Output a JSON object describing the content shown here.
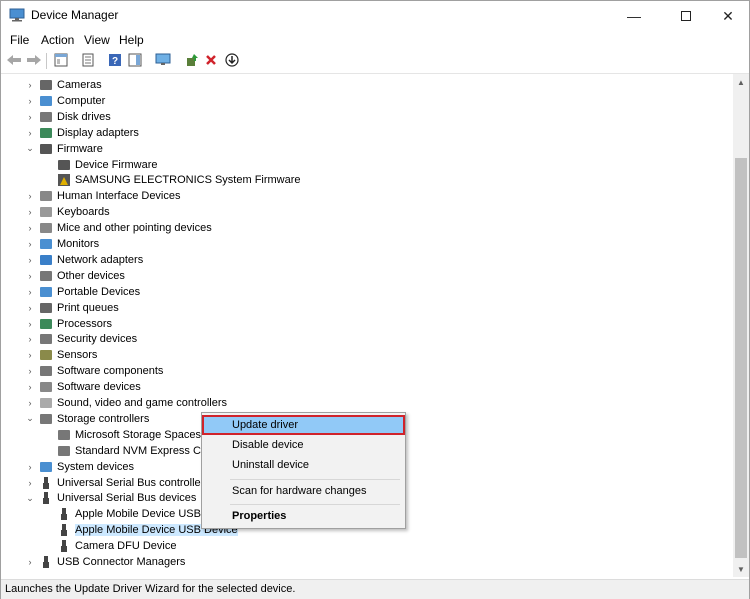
{
  "window": {
    "title": "Device Manager"
  },
  "menu": [
    "File",
    "Action",
    "View",
    "Help"
  ],
  "tree": [
    {
      "label": "Cameras",
      "level": 1,
      "expander": "collapsed",
      "icon": "camera-icon"
    },
    {
      "label": "Computer",
      "level": 1,
      "expander": "collapsed",
      "icon": "computer-icon"
    },
    {
      "label": "Disk drives",
      "level": 1,
      "expander": "collapsed",
      "icon": "disk-drive-icon"
    },
    {
      "label": "Display adapters",
      "level": 1,
      "expander": "collapsed",
      "icon": "display-adapter-icon"
    },
    {
      "label": "Firmware",
      "level": 1,
      "expander": "expanded",
      "icon": "firmware-icon"
    },
    {
      "label": "Device Firmware",
      "level": 2,
      "expander": "none",
      "icon": "firmware-icon"
    },
    {
      "label": "SAMSUNG ELECTRONICS System Firmware",
      "level": 2,
      "expander": "none",
      "icon": "warning-firmware-icon"
    },
    {
      "label": "Human Interface Devices",
      "level": 1,
      "expander": "collapsed",
      "icon": "hid-icon"
    },
    {
      "label": "Keyboards",
      "level": 1,
      "expander": "collapsed",
      "icon": "keyboard-icon"
    },
    {
      "label": "Mice and other pointing devices",
      "level": 1,
      "expander": "collapsed",
      "icon": "mouse-icon"
    },
    {
      "label": "Monitors",
      "level": 1,
      "expander": "collapsed",
      "icon": "monitor-icon"
    },
    {
      "label": "Network adapters",
      "level": 1,
      "expander": "collapsed",
      "icon": "network-adapter-icon"
    },
    {
      "label": "Other devices",
      "level": 1,
      "expander": "collapsed",
      "icon": "other-devices-icon"
    },
    {
      "label": "Portable Devices",
      "level": 1,
      "expander": "collapsed",
      "icon": "portable-device-icon"
    },
    {
      "label": "Print queues",
      "level": 1,
      "expander": "collapsed",
      "icon": "printer-icon"
    },
    {
      "label": "Processors",
      "level": 1,
      "expander": "collapsed",
      "icon": "processor-icon"
    },
    {
      "label": "Security devices",
      "level": 1,
      "expander": "collapsed",
      "icon": "security-icon"
    },
    {
      "label": "Sensors",
      "level": 1,
      "expander": "collapsed",
      "icon": "sensor-icon"
    },
    {
      "label": "Software components",
      "level": 1,
      "expander": "collapsed",
      "icon": "software-component-icon"
    },
    {
      "label": "Software devices",
      "level": 1,
      "expander": "collapsed",
      "icon": "software-device-icon"
    },
    {
      "label": "Sound, video and game controllers",
      "level": 1,
      "expander": "collapsed",
      "icon": "sound-icon"
    },
    {
      "label": "Storage controllers",
      "level": 1,
      "expander": "expanded",
      "icon": "storage-controller-icon"
    },
    {
      "label": "Microsoft Storage Spaces C",
      "level": 2,
      "expander": "none",
      "icon": "storage-controller-icon"
    },
    {
      "label": "Standard NVM Express Con",
      "level": 2,
      "expander": "none",
      "icon": "storage-controller-icon"
    },
    {
      "label": "System devices",
      "level": 1,
      "expander": "collapsed",
      "icon": "system-devices-icon"
    },
    {
      "label": "Universal Serial Bus controllers",
      "level": 1,
      "expander": "collapsed",
      "icon": "usb-icon"
    },
    {
      "label": "Universal Serial Bus devices",
      "level": 1,
      "expander": "expanded",
      "icon": "usb-icon"
    },
    {
      "label": "Apple Mobile Device USB C",
      "level": 2,
      "expander": "none",
      "icon": "usb-icon"
    },
    {
      "label": "Apple Mobile Device USB Device",
      "level": 2,
      "expander": "none",
      "icon": "usb-icon",
      "selected": true
    },
    {
      "label": "Camera DFU Device",
      "level": 2,
      "expander": "none",
      "icon": "usb-icon"
    },
    {
      "label": "USB Connector Managers",
      "level": 1,
      "expander": "collapsed",
      "icon": "usb-icon"
    }
  ],
  "context_menu": {
    "items": [
      {
        "label": "Update driver",
        "highlighted": true,
        "bold": false
      },
      {
        "label": "Disable device",
        "highlighted": false,
        "bold": false
      },
      {
        "label": "Uninstall device",
        "highlighted": false,
        "bold": false
      },
      {
        "label": "Scan for hardware changes",
        "highlighted": false,
        "bold": false
      },
      {
        "label": "Properties",
        "highlighted": false,
        "bold": true
      }
    ]
  },
  "status": {
    "text": "Launches the Update Driver Wizard for the selected device."
  },
  "colors": {
    "highlight": "#91c9f7",
    "highlight_border": "#d0232b",
    "selection": "#cce8ff"
  }
}
